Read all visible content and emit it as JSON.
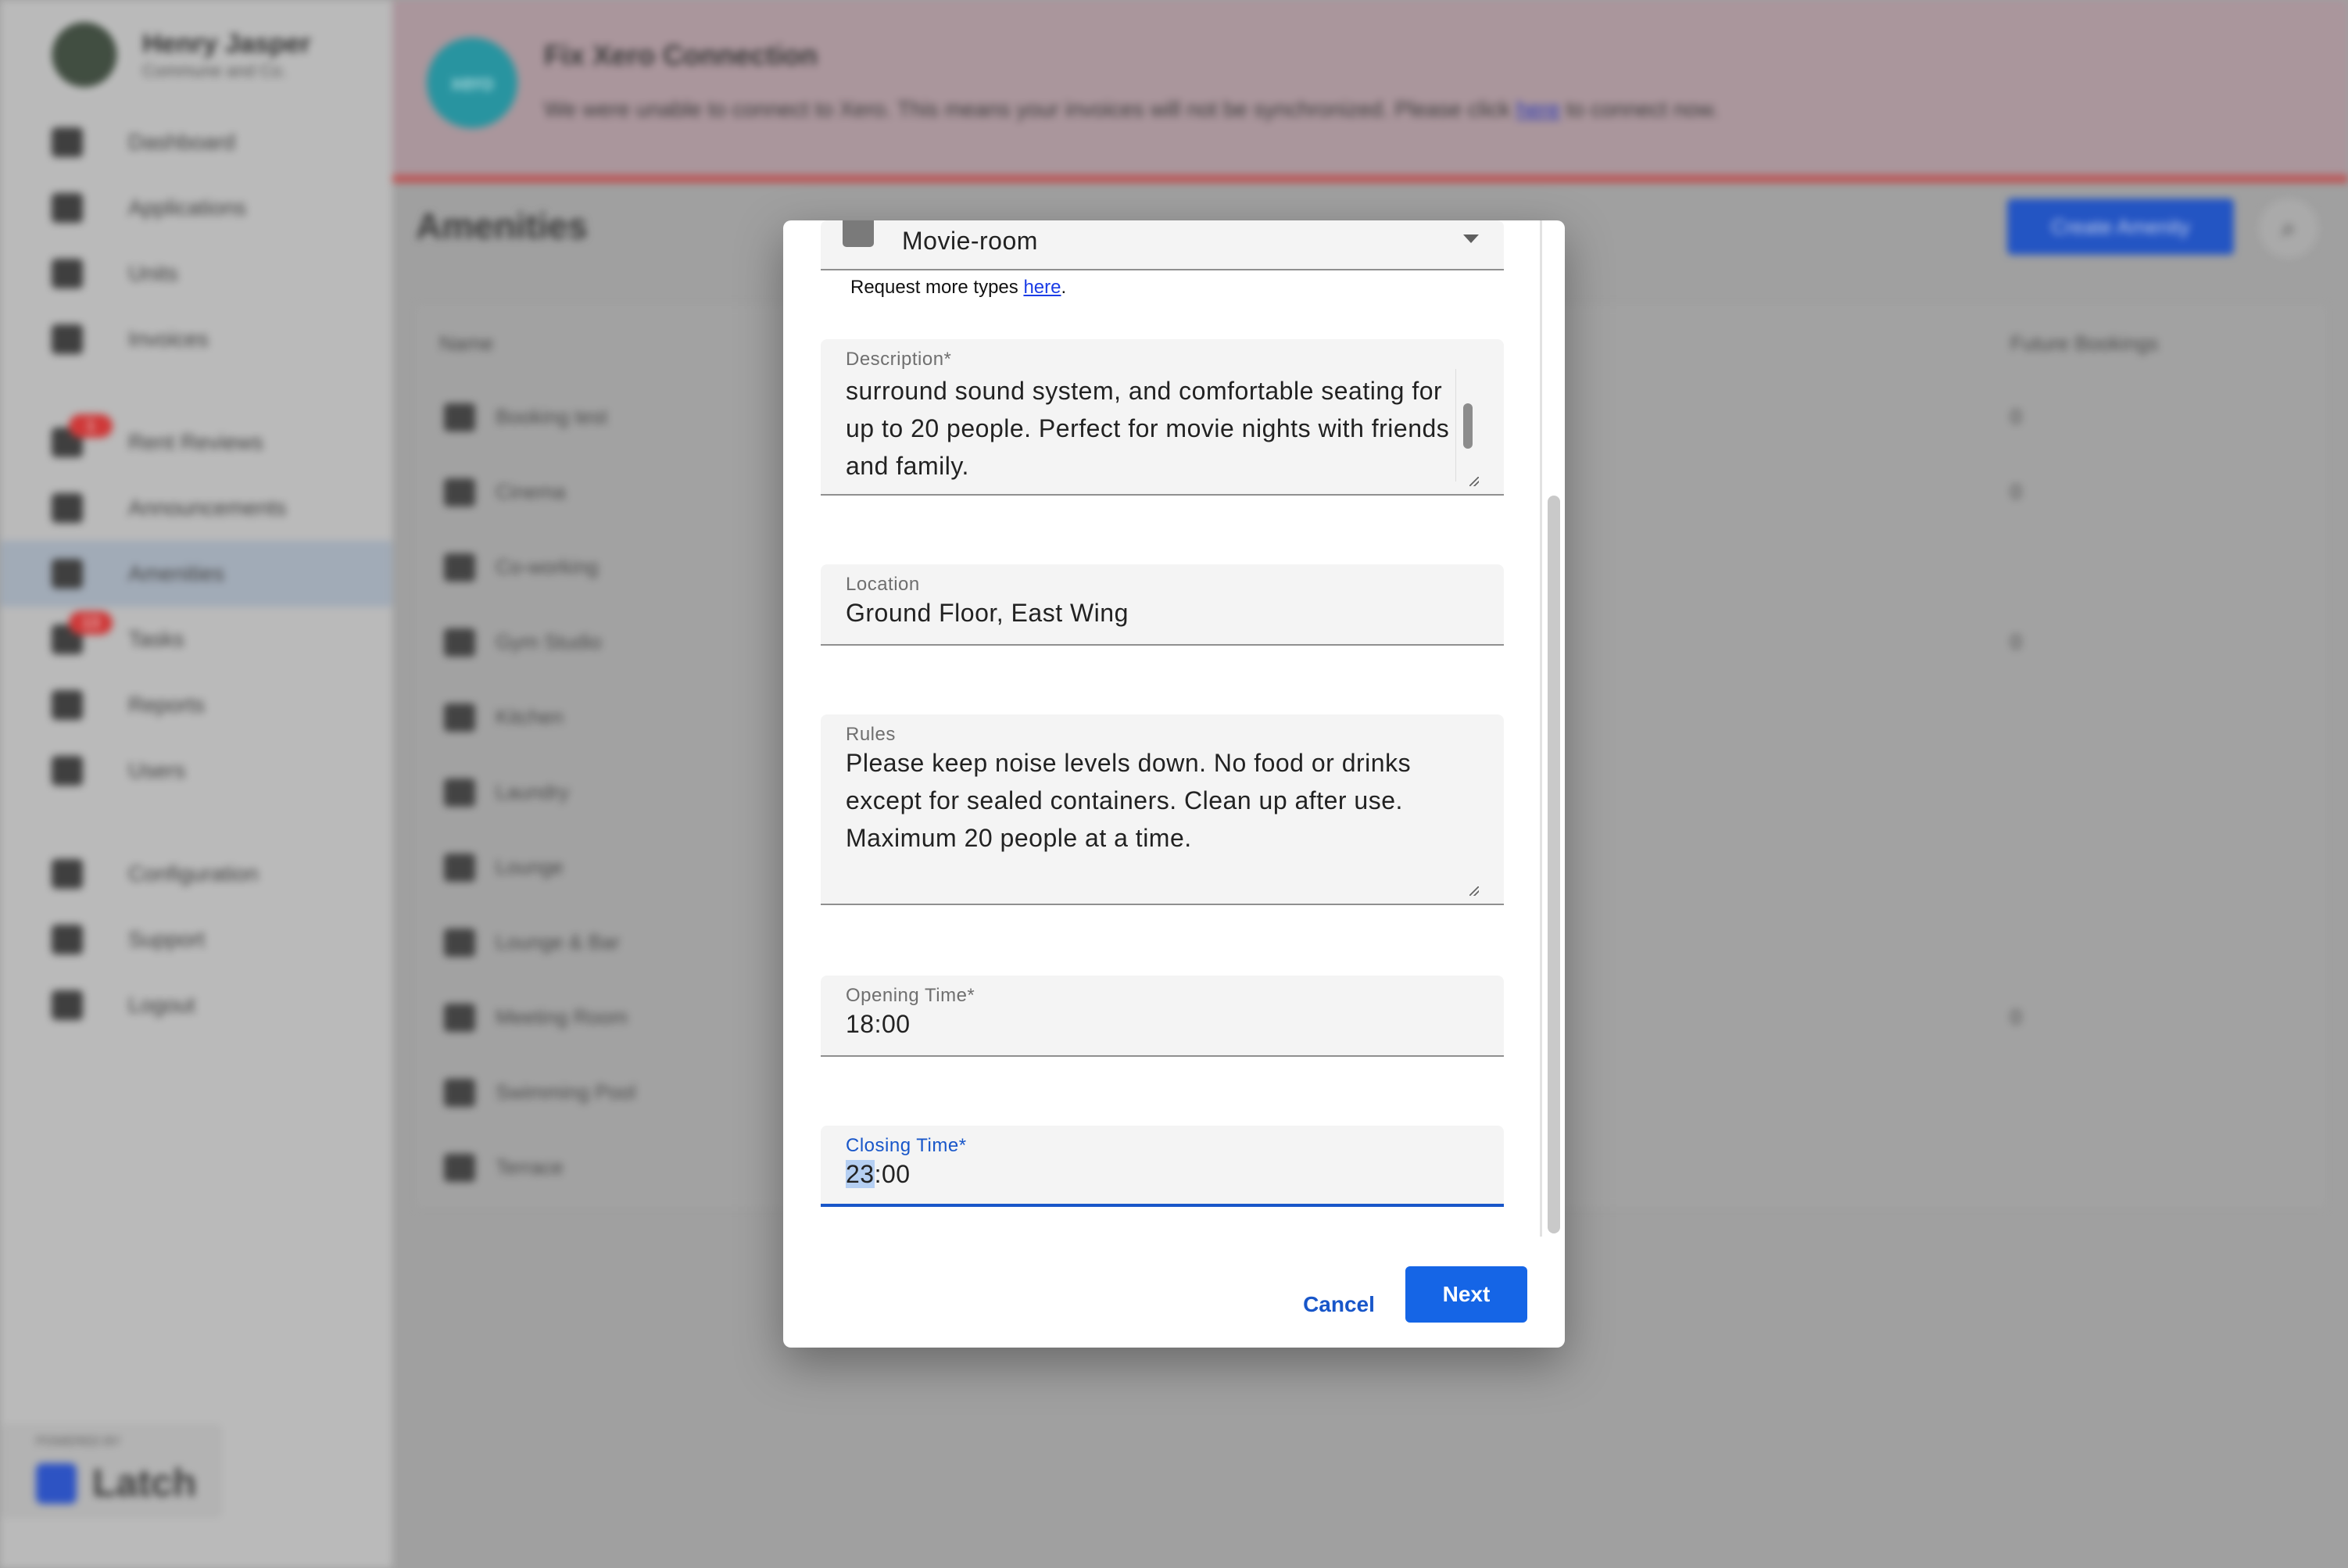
{
  "profile": {
    "name": "Henry Jasper",
    "company": "Commune and Co."
  },
  "nav": {
    "dashboard": "Dashboard",
    "applications": "Applications",
    "units": "Units",
    "invoices": "Invoices",
    "rent_reviews": "Rent Reviews",
    "rent_reviews_badge": "1",
    "announcements": "Announcements",
    "amenities": "Amenities",
    "tasks": "Tasks",
    "tasks_badge": "13",
    "reports": "Reports",
    "users": "Users",
    "configuration": "Configuration",
    "support": "Support",
    "logout": "Logout"
  },
  "brand": {
    "powered_by": "POWERED BY",
    "name": "Latch"
  },
  "banner": {
    "logo_text": "xero",
    "title": "Fix Xero Connection",
    "text_before": "We were unable to connect to Xero. This means your invoices will not be synchronized. Please click ",
    "link": "here",
    "text_after": " to connect now."
  },
  "page": {
    "title": "Amenities",
    "create_label": "Create Amenity",
    "search_icon": "search-icon"
  },
  "table": {
    "col_name": "Name",
    "col_future": "Future Bookings",
    "rows": [
      {
        "name": "Booking test",
        "future": "0"
      },
      {
        "name": "Cinema",
        "future": "0"
      },
      {
        "name": "Co-working",
        "future": ""
      },
      {
        "name": "Gym Studio",
        "future": "0"
      },
      {
        "name": "Kitchen",
        "future": ""
      },
      {
        "name": "Laundry",
        "future": ""
      },
      {
        "name": "Lounge",
        "future": ""
      },
      {
        "name": "Lounge & Bar",
        "future": ""
      },
      {
        "name": "Meeting Room",
        "future": "0"
      },
      {
        "name": "Swimming Pool",
        "future": ""
      },
      {
        "name": "Terrace",
        "future": ""
      }
    ]
  },
  "modal": {
    "type_value": "Movie-room",
    "request_text": "Request more types ",
    "request_link": "here",
    "request_end": ".",
    "description_label": "Description*",
    "description_value": "A private movie room with a large projection screen, surround sound system, and comfortable seating for up to 20 people. Perfect for movie nights with friends and family.",
    "location_label": "Location",
    "location_value": "Ground Floor, East Wing",
    "rules_label": "Rules",
    "rules_value": "Please keep noise levels down. No food or drinks except for sealed containers. Clean up after use. Maximum 20 people at a time.",
    "opening_label": "Opening Time*",
    "opening_value": "18:00",
    "closing_label": "Closing Time*",
    "closing_hour": "23",
    "closing_rest": ":00",
    "cancel_label": "Cancel",
    "next_label": "Next"
  },
  "colors": {
    "primary": "#1565e6",
    "focus": "#1856c9",
    "banner": "#b39ca3"
  }
}
